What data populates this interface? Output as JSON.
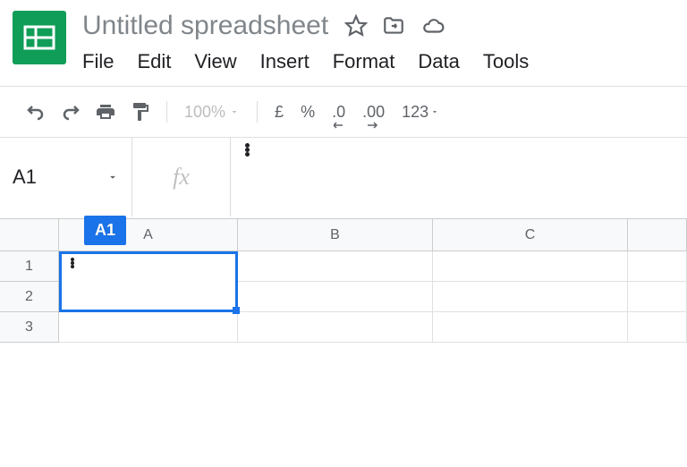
{
  "doc_title": "Untitled spreadsheet",
  "menu": {
    "file": "File",
    "edit": "Edit",
    "view": "View",
    "insert": "Insert",
    "format": "Format",
    "data": "Data",
    "tools": "Tools"
  },
  "toolbar": {
    "zoom": "100%",
    "currency": "£",
    "percent": "%",
    "dec_minus": ".0",
    "dec_plus": ".00",
    "more_fmt": "123"
  },
  "name_box": "A1",
  "fx_label": "fx",
  "active_cell_tag": "A1",
  "columns": [
    "A",
    "B",
    "C"
  ],
  "rows": [
    "1",
    "2",
    "3"
  ],
  "cell_a1_lines": [
    "",
    "",
    ""
  ]
}
